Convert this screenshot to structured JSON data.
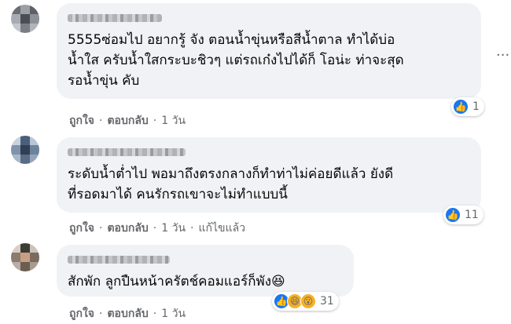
{
  "comments": [
    {
      "text": "5555ซ่อมไป อยากรู้ จัง ตอนน้ำขุ่นหรือสีน้ำตาล ทำได้บ่อ\nน้ำใส ครับน้ำใสกระบะชิวๆ แต่รถเก๋งไปได้ก็ โอน่ะ ท่าจะสุด\nรอน้ำขุ่น คับ",
      "reactions": {
        "icons": [
          "like-icon"
        ],
        "count": "1"
      },
      "actions": {
        "like": "ถูกใจ",
        "reply": "ตอบกลับ",
        "time": "1 วัน"
      }
    },
    {
      "text": "ระดับน้ำต่ำไป พอมาถึงตรงกลางก็ทำท่าไม่ค่อยดีแล้ว ยังดี\nที่รอดมาได้ คนรักรถเขาจะไม่ทำแบบนี้",
      "reactions": {
        "icons": [
          "like-icon"
        ],
        "count": "11"
      },
      "actions": {
        "like": "ถูกใจ",
        "reply": "ตอบกลับ",
        "time": "1 วัน",
        "edited": "แก้ไขแล้ว"
      }
    },
    {
      "text": "สักพัก ลูกปืนหน้าครัตช์คอมแอร์ก็พัง😆",
      "reactions": {
        "icons": [
          "like-icon",
          "haha-icon",
          "wow-icon"
        ],
        "count": "31"
      },
      "actions": {
        "like": "ถูกใจ",
        "reply": "ตอบกลับ",
        "time": "1 วัน"
      }
    }
  ],
  "more_glyph": "···",
  "dot": "·",
  "colors": {
    "bubble": "#f0f2f5",
    "like": "#1877f2",
    "secondary_text": "#65676b"
  }
}
